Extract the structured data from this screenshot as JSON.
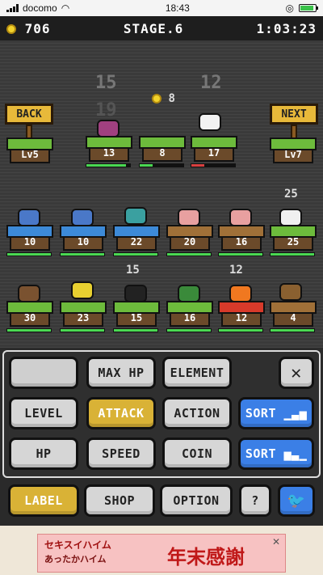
{
  "status_bar": {
    "carrier": "docomo",
    "time": "18:43"
  },
  "hud": {
    "coins": "706",
    "stage": "STAGE.6",
    "timer": "1:03:23"
  },
  "nav": {
    "back_label": "BACK",
    "next_label": "NEXT",
    "back_level": "Lv5",
    "next_level": "Lv7"
  },
  "top_row": {
    "counts": [
      "15",
      "12"
    ],
    "boss_counts": [
      "19"
    ],
    "center_coin": "8",
    "left_attack": "13",
    "center_coin_value": "8",
    "right_attack": "17"
  },
  "row2": {
    "badge": "25",
    "values": [
      "10",
      "10",
      "22",
      "20",
      "16",
      "25"
    ]
  },
  "row3": {
    "badges": [
      "15",
      "12"
    ],
    "values": [
      "30",
      "23",
      "15",
      "16",
      "12",
      "4"
    ]
  },
  "buttons": {
    "max_hp": "MAX HP",
    "element": "ELEMENT",
    "level": "LEVEL",
    "attack": "ATTACK",
    "action": "ACTION",
    "sort1": "SORT",
    "hp": "HP",
    "speed": "SPEED",
    "coin": "COIN",
    "sort2": "SORT",
    "label": "LABEL",
    "shop": "SHOP",
    "option": "OPTION",
    "help": "?"
  },
  "ad": {
    "line1": "セキスイハイム",
    "line2": "あったかハイム",
    "headline": "年末感謝",
    "close": "✕"
  },
  "colors": {
    "accent_gold": "#d9b236",
    "accent_blue": "#3b7fe6",
    "hp_green": "#4ad852"
  }
}
